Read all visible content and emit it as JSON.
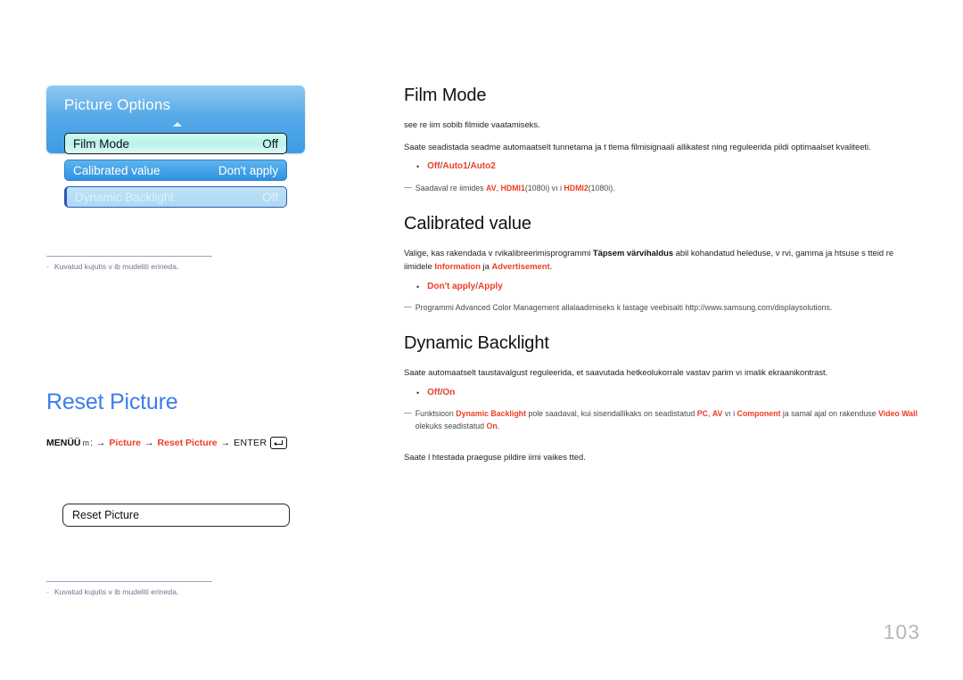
{
  "osd": {
    "title": "Picture Options",
    "scroll_indicator": "up-triangle",
    "rows": [
      {
        "label": "Film Mode",
        "value": "Off",
        "state": "selected"
      },
      {
        "label": "Calibrated value",
        "value": "Don't apply",
        "state": "normal"
      },
      {
        "label": "Dynamic Backlight",
        "value": "Off",
        "state": "disabled"
      }
    ]
  },
  "notes": {
    "image_disclaimer": "Kuvatud kujutis v ib mudeliti erineda.",
    "dash": "-"
  },
  "reset_picture": {
    "heading": "Reset Picture",
    "breadcrumb": {
      "menu_label": "MENÜÜ",
      "remote_glyph": "m",
      "colon": ":",
      "arrow": "→",
      "step1": "Picture",
      "step2": "Reset Picture",
      "enter_label": "ENTER",
      "enter_icon": "enter-key-icon"
    },
    "osd_box_label": "Reset Picture",
    "description": "Saate l htestada praeguse pildire iimi vaikes tted."
  },
  "sections": [
    {
      "id": "film-mode",
      "title": "Film Mode",
      "paragraphs": [
        "see re iim sobib filmide vaatamiseks.",
        "Saate seadistada seadme automaatselt tunnetama ja t  tlema filmisignaali allikatest ning reguleerida pildi optimaalset kvaliteeti."
      ],
      "options": {
        "values": [
          "Off",
          "Auto1",
          "Auto2"
        ],
        "separator": "/"
      },
      "note": {
        "mark": "―",
        "prefix": "Saadaval re iimides ",
        "parts": [
          {
            "text": "AV",
            "highlight": true
          },
          {
            "text": ", ",
            "highlight": false
          },
          {
            "text": "HDMI1",
            "highlight": true
          },
          {
            "text": "(1080i) vı i ",
            "highlight": false
          },
          {
            "text": "HDMI2",
            "highlight": true
          },
          {
            "text": "(1080i).",
            "highlight": false
          }
        ]
      }
    },
    {
      "id": "calibrated-value",
      "title": "Calibrated value",
      "paragraph_parts": [
        {
          "text": "Valige, kas rakendada v rvikalibreerimisprogrammi ",
          "style": "normal"
        },
        {
          "text": "Täpsem värvihaldus",
          "style": "strong"
        },
        {
          "text": " abil kohandatud heleduse, v rvi, gamma ja  htsuse s tteid re iimidele ",
          "style": "normal"
        },
        {
          "text": "Information",
          "style": "highlight"
        },
        {
          "text": " ja ",
          "style": "normal"
        },
        {
          "text": "Advertisement",
          "style": "highlight"
        },
        {
          "text": ".",
          "style": "normal"
        }
      ],
      "options": {
        "values": [
          "Don't apply",
          "Apply"
        ],
        "separator": "/"
      },
      "note": {
        "mark": "―",
        "text": "Programmi Advanced Color Management allalaadimiseks k lastage veebisaiti http://www.samsung.com/displaysolutions."
      }
    },
    {
      "id": "dynamic-backlight",
      "title": "Dynamic Backlight",
      "paragraphs": [
        "Saate automaatselt taustavalgust reguleerida, et saavutada hetkeolukorrale vastav parim vı imalik ekraanikontrast."
      ],
      "options": {
        "values": [
          "Off",
          "On"
        ],
        "separator": "/"
      },
      "note": {
        "mark": "―",
        "parts": [
          {
            "text": "Funktsioon ",
            "style": "normal"
          },
          {
            "text": "Dynamic Backlight",
            "style": "highlight"
          },
          {
            "text": " pole saadaval, kui sisendallikaks on seadistatud ",
            "style": "normal"
          },
          {
            "text": "PC",
            "style": "highlight"
          },
          {
            "text": ", ",
            "style": "normal"
          },
          {
            "text": "AV",
            "style": "highlight"
          },
          {
            "text": " vı i ",
            "style": "normal"
          },
          {
            "text": "Component",
            "style": "highlight"
          },
          {
            "text": " ja samal ajal on rakenduse ",
            "style": "normal"
          },
          {
            "text": "Video Wall",
            "style": "highlight"
          },
          {
            "text": " olekuks seadistatud ",
            "style": "normal"
          },
          {
            "text": "On",
            "style": "highlight"
          },
          {
            "text": ".",
            "style": "normal"
          }
        ]
      }
    }
  ],
  "page_number": "103",
  "colors": {
    "accent_red": "#ef3d23",
    "heading_blue": "#3d7eea",
    "osd_blue": "#3e9ce4",
    "note_gray": "#6d7590"
  }
}
